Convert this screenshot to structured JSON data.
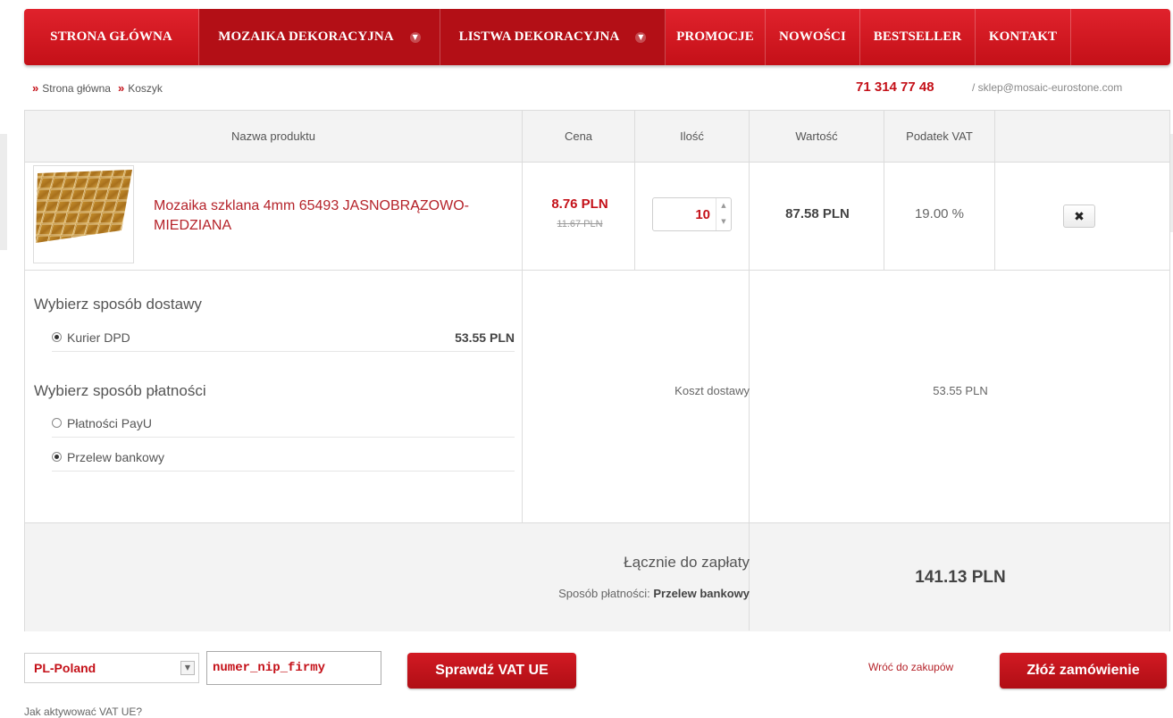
{
  "nav": {
    "items": [
      {
        "label": "STRONA GŁÓWNA",
        "dropdown": false,
        "active": false
      },
      {
        "label": "MOZAIKA DEKORACYJNA",
        "dropdown": true,
        "active": true
      },
      {
        "label": "LISTWA DEKORACYJNA",
        "dropdown": true,
        "active": true
      },
      {
        "label": "PROMOCJE",
        "dropdown": false,
        "active": false
      },
      {
        "label": "NOWOŚCI",
        "dropdown": false,
        "active": false
      },
      {
        "label": "BESTSELLER",
        "dropdown": false,
        "active": false
      },
      {
        "label": "KONTAKT",
        "dropdown": false,
        "active": false
      }
    ]
  },
  "breadcrumb": {
    "separator": "»",
    "items": [
      "Strona główna",
      "Koszyk"
    ]
  },
  "contact": {
    "phone": "71 314 77 48",
    "email": "/ sklep@mosaic-eurostone.com"
  },
  "cart": {
    "headers": {
      "name": "Nazwa produktu",
      "price": "Cena",
      "qty": "Ilość",
      "value": "Wartość",
      "vat": "Podatek VAT"
    },
    "item": {
      "name": "Mozaika szklana 4mm 65493 JASNOBRĄZOWO-MIEDZIANA",
      "price": "8.76 PLN",
      "old_price": "11.67 PLN",
      "qty": "10",
      "value": "87.58 PLN",
      "vat": "19.00 %"
    },
    "delivery": {
      "title": "Wybierz sposób dostawy",
      "options": [
        {
          "label": "Kurier DPD",
          "amount": "53.55 PLN",
          "selected": true
        }
      ]
    },
    "payment": {
      "title": "Wybierz sposób płatności",
      "options": [
        {
          "label": "Płatności PayU",
          "selected": false
        },
        {
          "label": "Przelew bankowy",
          "selected": true
        }
      ]
    },
    "shipping_cost_label": "Koszt dostawy",
    "shipping_cost": "53.55 PLN",
    "total_label": "Łącznie do zapłaty",
    "payment_method_label": "Sposób płatności:",
    "payment_method": "Przelew bankowy",
    "total": "141.13 PLN"
  },
  "footer": {
    "country": "PL-Poland",
    "nip_value": "numer_nip_firmy",
    "check_vat": "Sprawdź VAT UE",
    "back": "Wróć do zakupów",
    "order": "Złóż zamówienie",
    "howto": "Jak aktywować VAT UE?"
  },
  "colors": {
    "brand_red": "#c41018",
    "link_red": "#b5232a"
  }
}
